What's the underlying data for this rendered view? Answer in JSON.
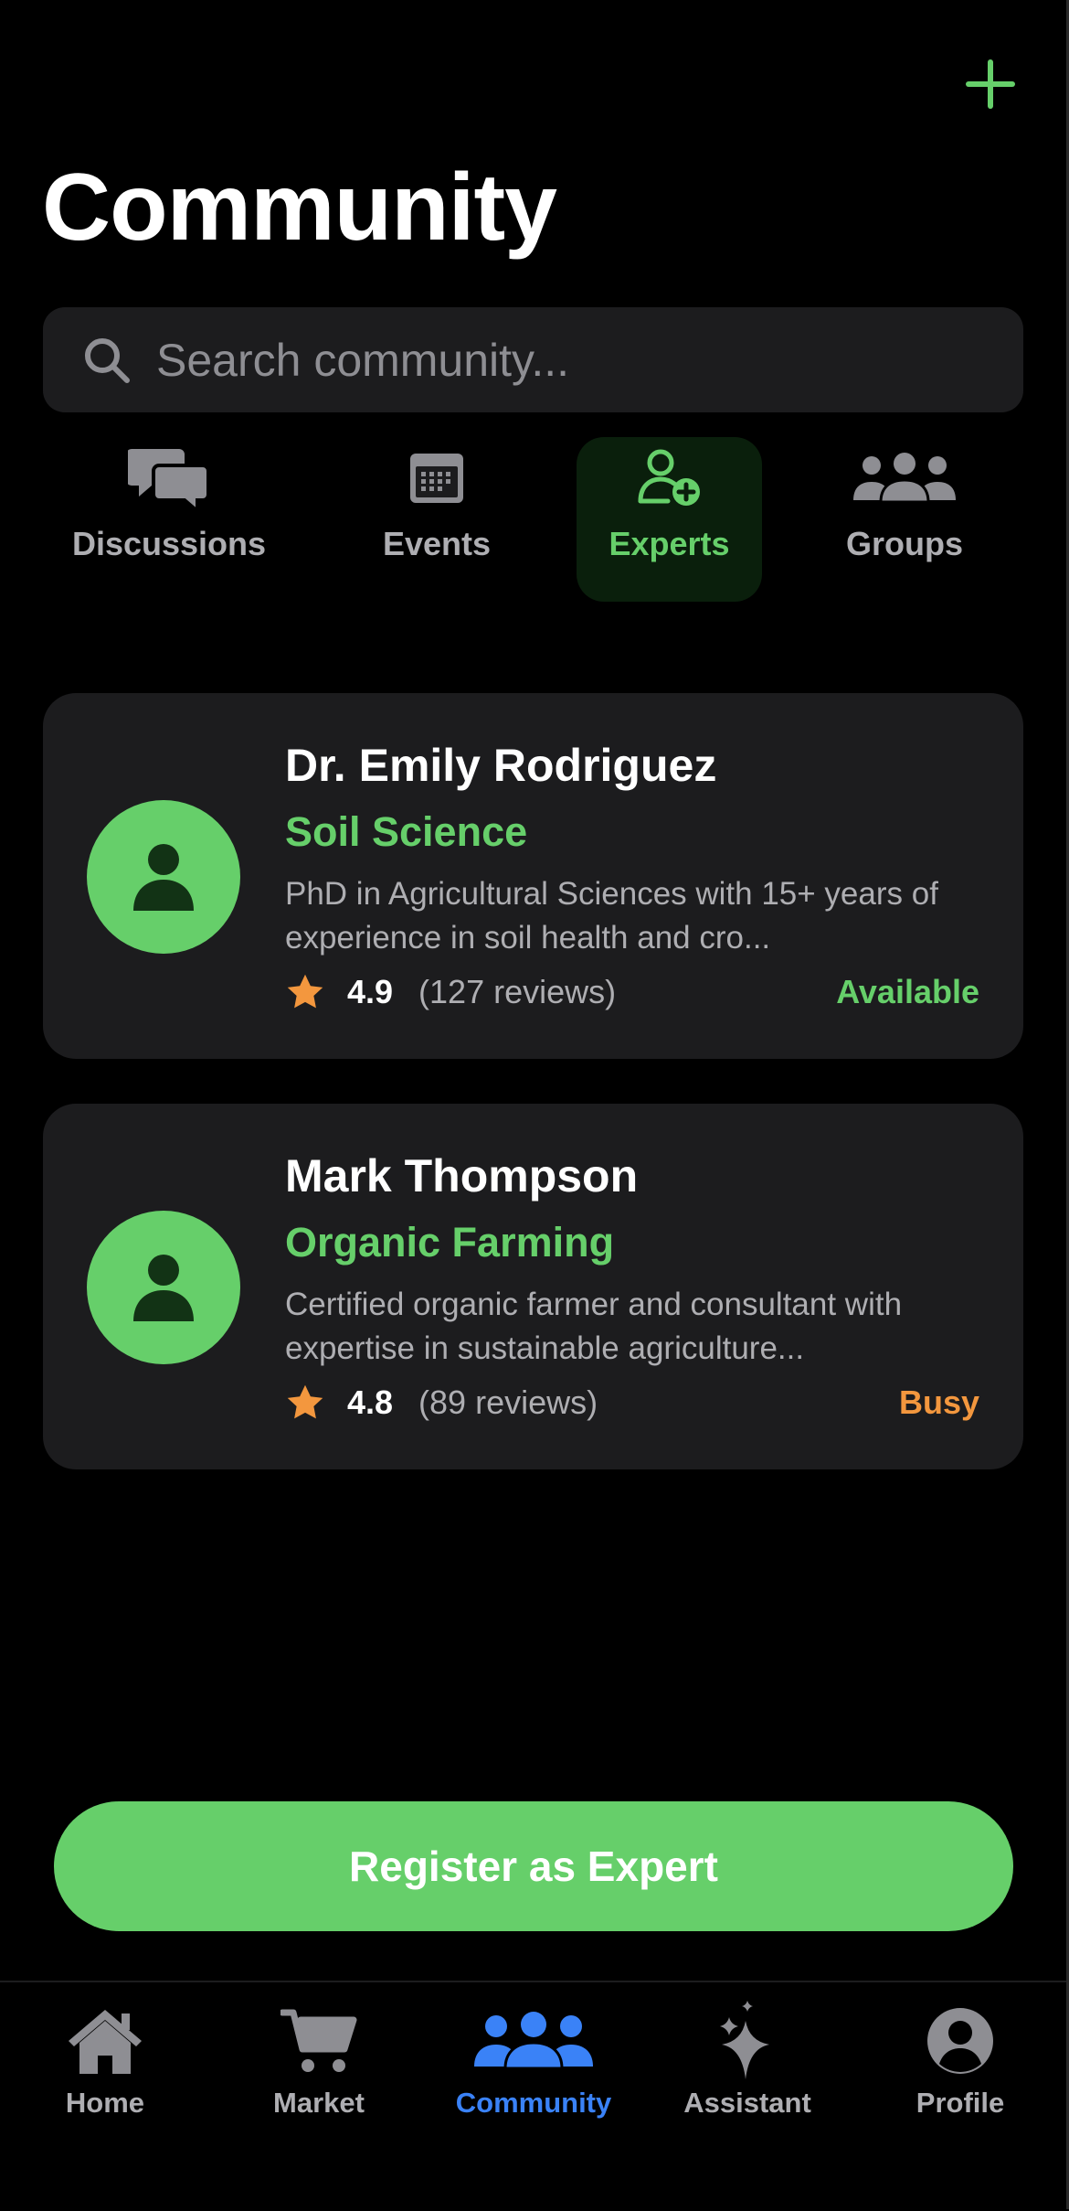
{
  "page": {
    "title": "Community"
  },
  "search": {
    "placeholder": "Search community..."
  },
  "tabs": [
    {
      "label": "Discussions",
      "icon": "chat-bubbles-icon",
      "active": false
    },
    {
      "label": "Events",
      "icon": "calendar-icon",
      "active": false
    },
    {
      "label": "Experts",
      "icon": "person-add-icon",
      "active": true
    },
    {
      "label": "Groups",
      "icon": "group-icon",
      "active": false
    }
  ],
  "experts": [
    {
      "name": "Dr. Emily Rodriguez",
      "field": "Soil Science",
      "bio": "PhD in Agricultural Sciences with 15+ years of experience in soil health and cro...",
      "rating": "4.9",
      "reviews": "(127 reviews)",
      "status": "Available",
      "status_color": "#66cf6a"
    },
    {
      "name": "Mark Thompson",
      "field": "Organic Farming",
      "bio": "Certified organic farmer and consultant with expertise in sustainable agriculture...",
      "rating": "4.8",
      "reviews": "(89 reviews)",
      "status": "Busy",
      "status_color": "#f3973e"
    }
  ],
  "register_button": {
    "label": "Register as Expert"
  },
  "bottom_nav": [
    {
      "label": "Home",
      "icon": "house-icon",
      "active": false
    },
    {
      "label": "Market",
      "icon": "cart-icon",
      "active": false
    },
    {
      "label": "Community",
      "icon": "people-icon",
      "active": true
    },
    {
      "label": "Assistant",
      "icon": "sparkles-icon",
      "active": false
    },
    {
      "label": "Profile",
      "icon": "profile-circle-icon",
      "active": false
    }
  ],
  "colors": {
    "accent_green": "#66cf6a",
    "accent_blue": "#3a82f7",
    "star_orange": "#f3973e",
    "card_bg": "#1c1c1e",
    "muted_text": "#aeaeb2"
  }
}
